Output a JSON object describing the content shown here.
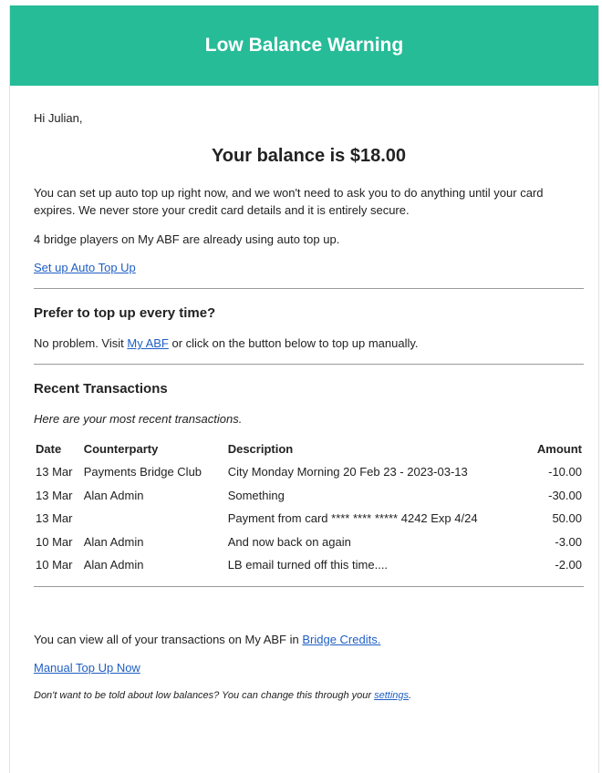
{
  "header": {
    "title": "Low Balance Warning"
  },
  "greeting": "Hi Julian,",
  "balance_text": "Your balance is $18.00",
  "auto_topup": {
    "description": "You can set up auto top up right now, and we won't need to ask you to do anything until your card expires. We never store your credit card details and it is entirely secure.",
    "usage": "4 bridge players on My ABF are already using auto top up.",
    "link_label": "Set up Auto Top Up"
  },
  "manual": {
    "heading": "Prefer to top up every time?",
    "text_before": "No problem. Visit ",
    "link_label": "My ABF",
    "text_after": " or click on the button below to top up manually."
  },
  "transactions": {
    "heading": "Recent Transactions",
    "intro": "Here are your most recent transactions.",
    "columns": [
      "Date",
      "Counterparty",
      "Description",
      "Amount"
    ],
    "rows": [
      {
        "date": "13 Mar",
        "counterparty": "Payments Bridge Club",
        "description": "City Monday Morning 20 Feb 23 - 2023-03-13",
        "amount": "-10.00"
      },
      {
        "date": "13 Mar",
        "counterparty": "Alan Admin",
        "description": "Something",
        "amount": "-30.00"
      },
      {
        "date": "13 Mar",
        "counterparty": "",
        "description": "Payment from card **** **** ***** 4242 Exp 4/24",
        "amount": "50.00"
      },
      {
        "date": "10 Mar",
        "counterparty": "Alan Admin",
        "description": "And now back on again",
        "amount": "-3.00"
      },
      {
        "date": "10 Mar",
        "counterparty": "Alan Admin",
        "description": "LB email turned off this time....",
        "amount": "-2.00"
      }
    ]
  },
  "bottom": {
    "view_text": "You can view all of your transactions on My ABF in ",
    "view_link": "Bridge Credits.",
    "manual_link": "Manual Top Up Now",
    "footer_text": "Don't want to be told about low balances? You can change this through your ",
    "footer_link": "settings",
    "footer_end": "."
  },
  "colors": {
    "header_bg": "#26bc98",
    "link": "#1f5fc4"
  }
}
